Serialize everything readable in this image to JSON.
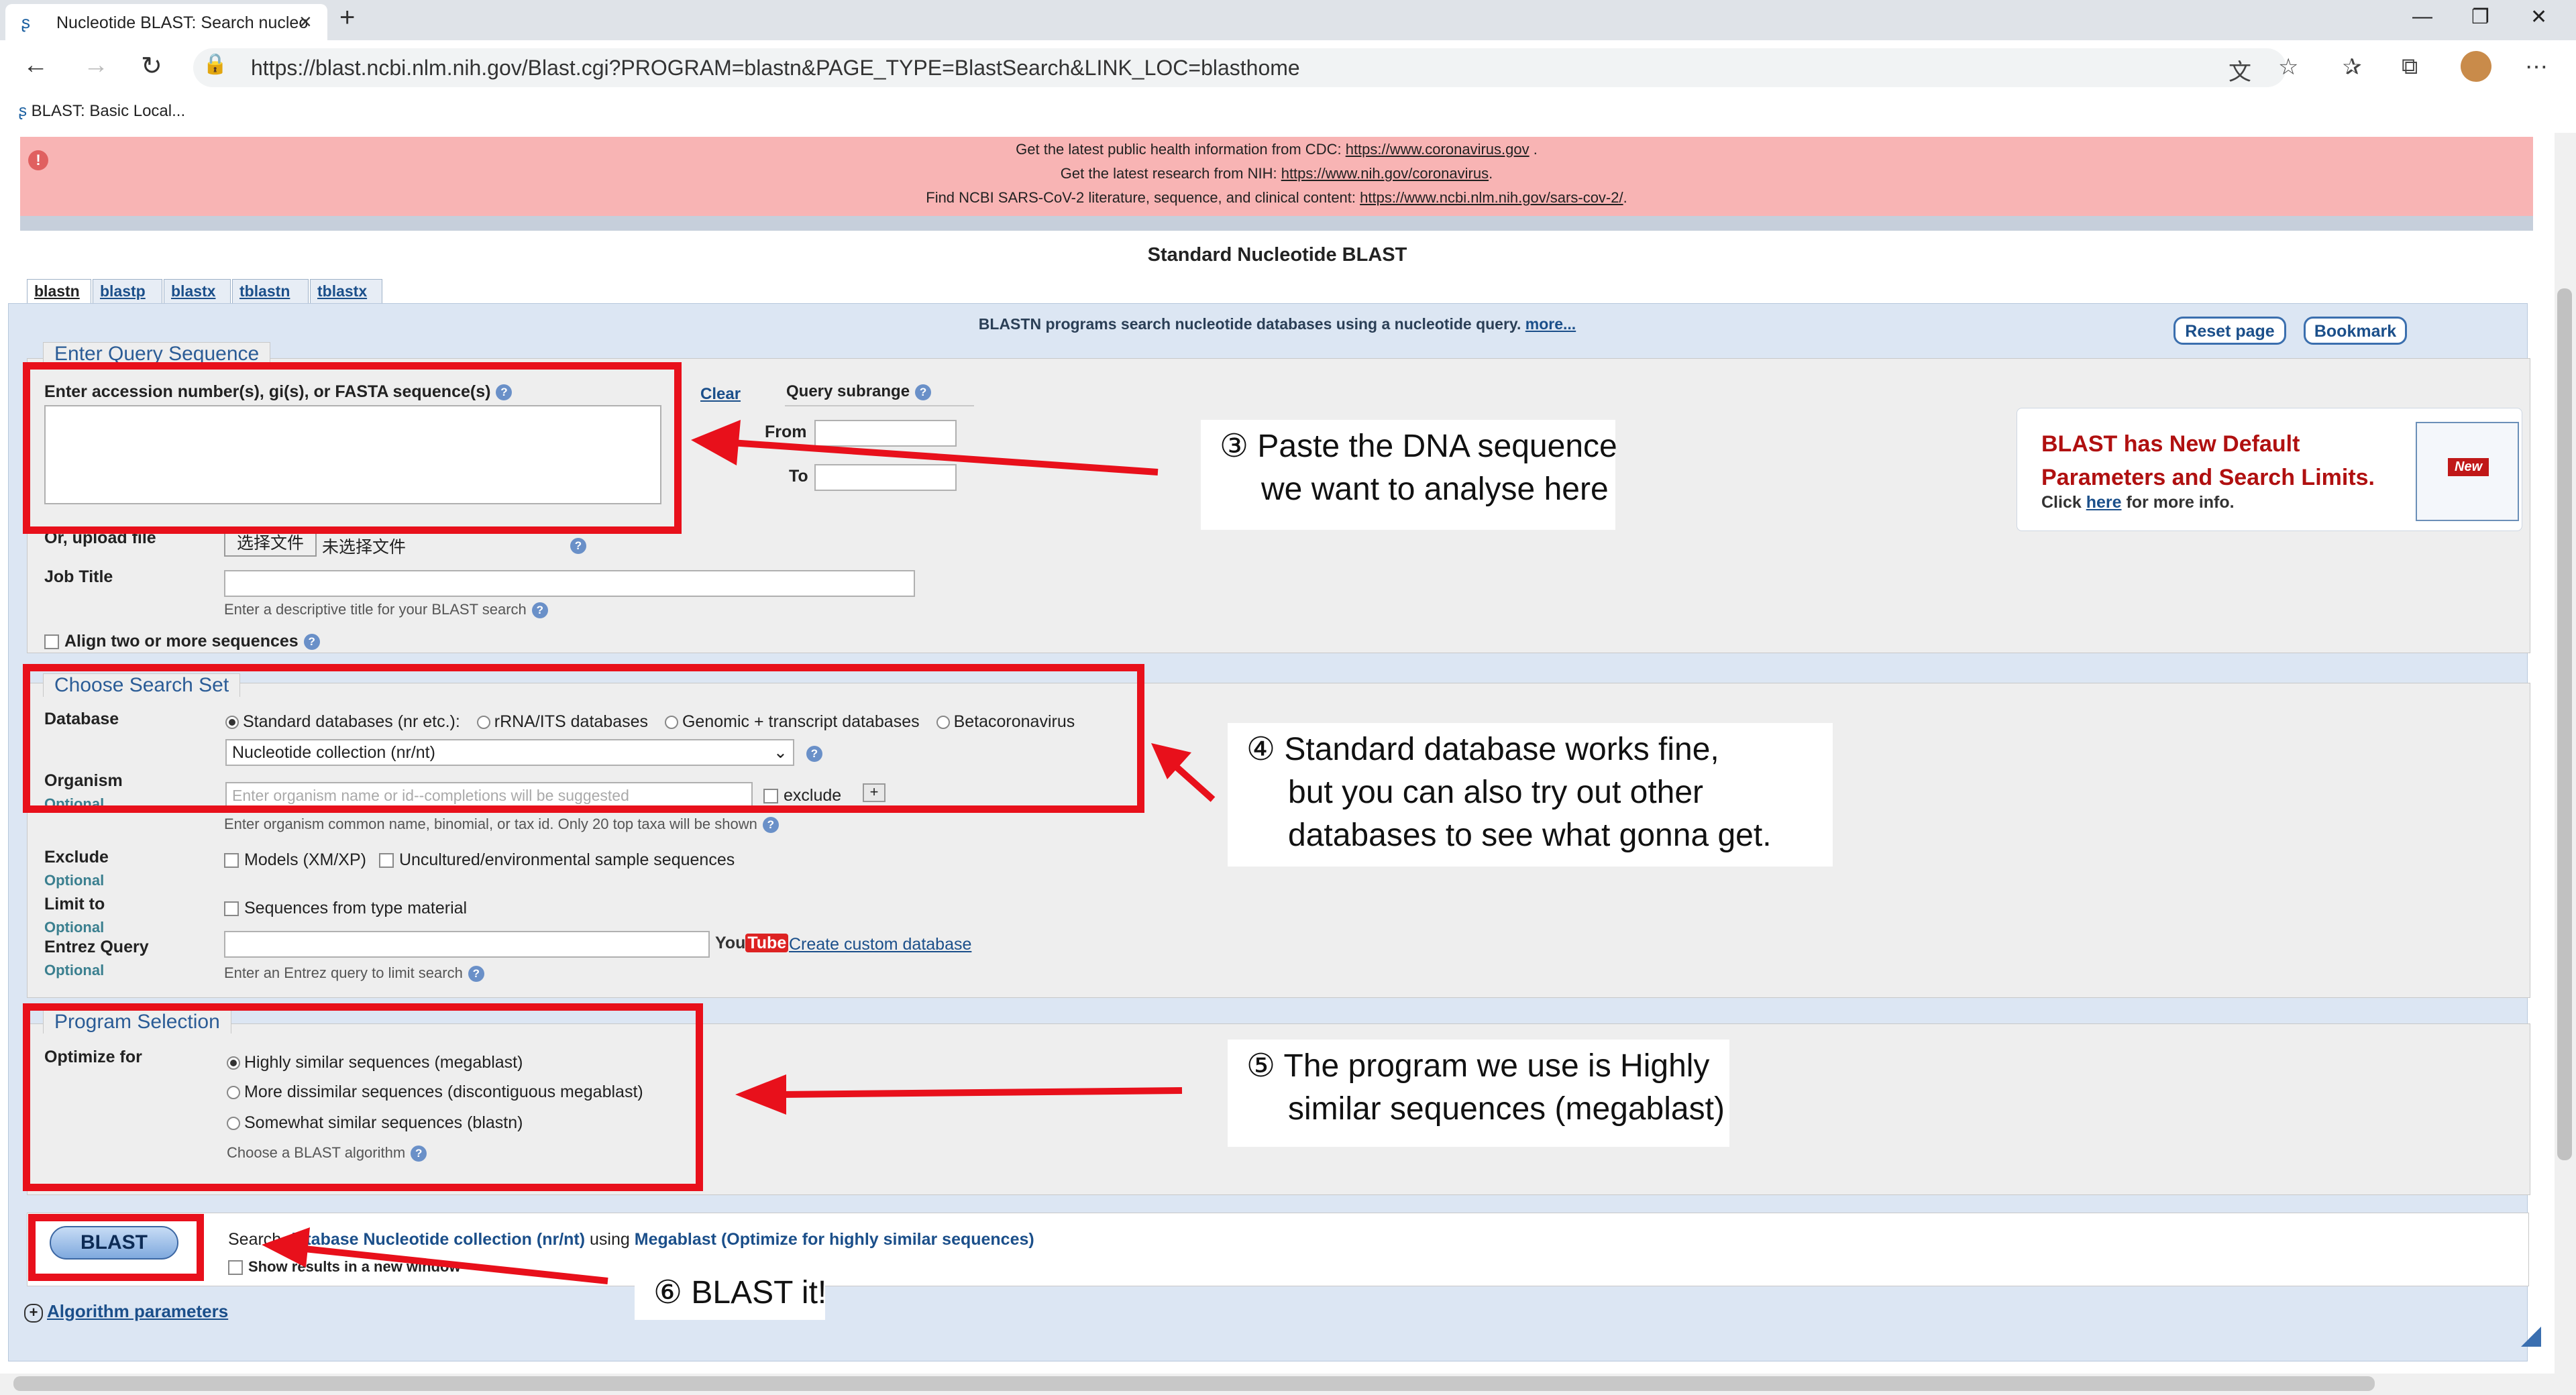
{
  "browser": {
    "tab_title": "Nucleotide BLAST: Search nucleo",
    "url": "https://blast.ncbi.nlm.nih.gov/Blast.cgi?PROGRAM=blastn&PAGE_TYPE=BlastSearch&LINK_LOC=blasthome",
    "favorite": "BLAST: Basic Local...",
    "new_tab": "+",
    "close": "×"
  },
  "alert": {
    "line1_pre": "Get the latest public health information from CDC: ",
    "line1_link": "https://www.coronavirus.gov",
    "line1_post": " .",
    "line2_pre": "Get the latest research from NIH: ",
    "line2_link": "https://www.nih.gov/coronavirus",
    "line2_post": ".",
    "line3_pre": "Find NCBI SARS-CoV-2 literature, sequence, and clinical content: ",
    "line3_link": "https://www.ncbi.nlm.nih.gov/sars-cov-2/",
    "line3_post": "."
  },
  "page": {
    "title": "Standard Nucleotide BLAST",
    "tabs": [
      "blastn",
      "blastp",
      "blastx",
      "tblastn",
      "tblastx"
    ],
    "intro": "BLASTN programs search nucleotide databases using a nucleotide query. ",
    "intro_more": "more...",
    "reset_page": "Reset page",
    "bookmark": "Bookmark"
  },
  "query": {
    "legend": "Enter Query Sequence",
    "label": "Enter accession number(s), gi(s), or FASTA sequence(s)",
    "clear": "Clear",
    "subrange": "Query subrange",
    "from": "From",
    "to": "To",
    "upload_label": "Or, upload file",
    "upload_button": "选择文件",
    "upload_status": "未选择文件",
    "job_title_label": "Job Title",
    "job_title_hint": "Enter a descriptive title for your BLAST search",
    "align_two": "Align two or more sequences"
  },
  "new_defaults": {
    "heading1": "BLAST has New Default",
    "heading2": "Parameters and Search Limits.",
    "click": "Click ",
    "here": "here",
    "more_info": " for more info.",
    "badge": "New"
  },
  "search_set": {
    "legend": "Choose Search Set",
    "database_label": "Database",
    "db_options": [
      "Standard databases (nr etc.):",
      "rRNA/ITS databases",
      "Genomic + transcript databases",
      "Betacoronavirus"
    ],
    "db_select": "Nucleotide collection (nr/nt)",
    "organism_label": "Organism",
    "optional": "Optional",
    "organism_placeholder": "Enter organism name or id--completions will be suggested",
    "exclude_check": "exclude",
    "plus": "+",
    "organism_hint": "Enter organism common name, binomial, or tax id. Only 20 top taxa will be shown",
    "exclude_label": "Exclude",
    "exclude_models": "Models (XM/XP)",
    "exclude_uncultured": "Uncultured/environmental sample sequences",
    "limit_label": "Limit to",
    "limit_type": "Sequences from type material",
    "entrez_label": "Entrez Query",
    "youtube_you": "You",
    "youtube_tube": "Tube",
    "custom_db": "Create custom database",
    "entrez_hint": "Enter an Entrez query to limit search"
  },
  "program": {
    "legend": "Program Selection",
    "optimize_label": "Optimize for",
    "options": [
      "Highly similar sequences (megablast)",
      "More dissimilar sequences (discontiguous megablast)",
      "Somewhat similar sequences (blastn)"
    ],
    "hint": "Choose a BLAST algorithm"
  },
  "blast": {
    "button": "BLAST",
    "search_pre": "Search ",
    "search_db": "database Nucleotide collection (nr/nt)",
    "using": " using ",
    "algo": "Megablast (Optimize for highly similar sequences)",
    "new_window": "Show results in a new window",
    "algo_params": "Algorithm parameters"
  },
  "annotations": {
    "step3_l1": "③ Paste the DNA sequence",
    "step3_l2": "we want to analyse here",
    "step4_l1": "④ Standard database works fine,",
    "step4_l2": "but you can also try out other",
    "step4_l3": "databases to see what gonna get.",
    "step5_l1": "⑤ The program we use is Highly",
    "step5_l2": "similar sequences (megablast)",
    "step6": "⑥ BLAST it!",
    "annotation_color": "#e8101b"
  }
}
